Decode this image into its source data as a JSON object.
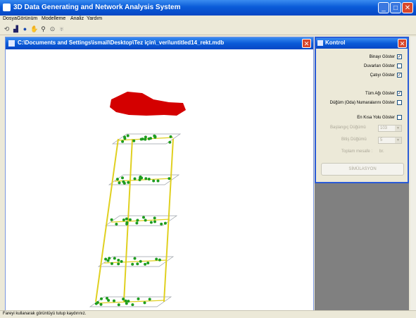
{
  "window": {
    "title": "3D Data Generating and Network Analysis System"
  },
  "menu": [
    "Dosya",
    "Görünüm",
    "Modelleme",
    "Analiz",
    "Yardım"
  ],
  "toolbar_icons": [
    "open-icon",
    "chart-icon",
    "globe-icon",
    "pan-icon",
    "zoom-icon",
    "refresh-icon",
    "settings-icon"
  ],
  "document": {
    "title": "C:\\Documents and Settings\\ismail\\Desktop\\Tez için\\_veri\\untitled14_rekt.mdb"
  },
  "kontrol": {
    "title": "Kontrol",
    "binayi_goster": {
      "label": "Binayı Göster",
      "checked": true
    },
    "duvarlari_goster": {
      "label": "Duvarları Göster",
      "checked": false
    },
    "catiyi_goster": {
      "label": "Çatıyı Göster",
      "checked": true
    },
    "tum_agi_goster": {
      "label": "Tüm Ağı Göster",
      "checked": true
    },
    "dugum_no_goster": {
      "label": "Düğüm (Oda) Numaralarını Göster",
      "checked": false
    },
    "en_kisa_yol": {
      "label": "En Kısa Yolu Göster",
      "checked": false
    },
    "baslangic": {
      "label": "Başlangıç Düğümü",
      "value": "103"
    },
    "bitis": {
      "label": "Bitiş Düğümü",
      "value": "5"
    },
    "toplam_mesafe": {
      "label": "Toplam mesafe :",
      "value": "br."
    },
    "simulasyon": "SİMÜLASYON"
  },
  "status": "Fareyi kullanarak görüntüyü tutup kaydırınız.",
  "colors": {
    "accent": "#0a5bd8",
    "roof": "#d40000",
    "node": "#1e9d1e",
    "edge": "#e0d020"
  }
}
